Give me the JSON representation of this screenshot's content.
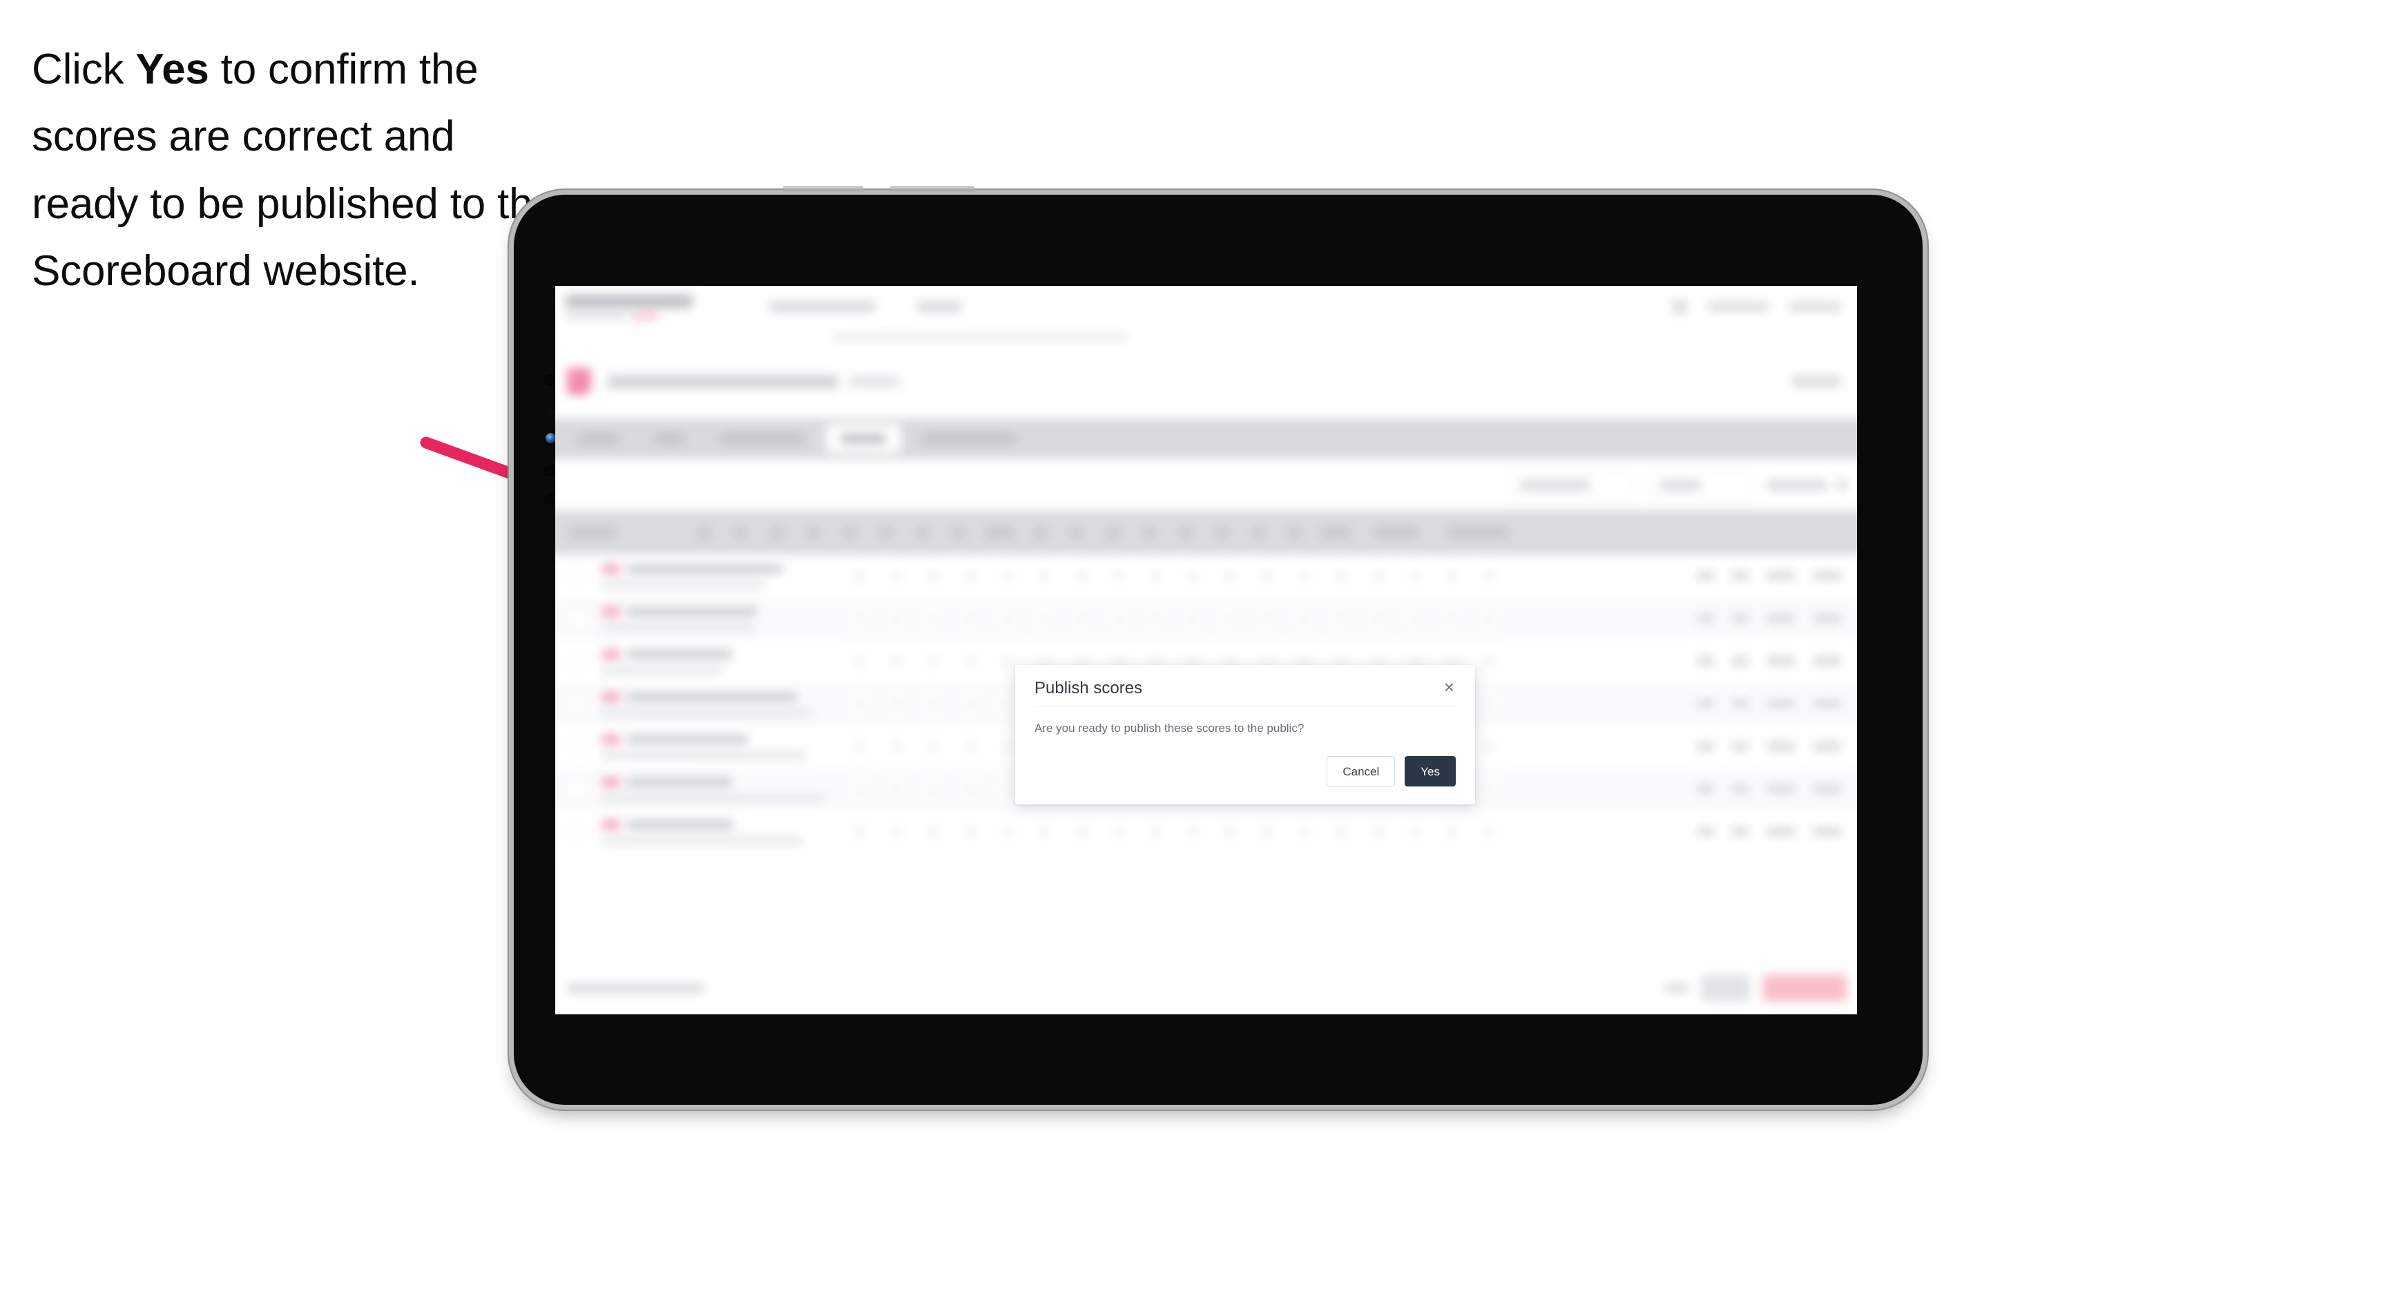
{
  "caption": {
    "part1": "Click ",
    "emphasis": "Yes",
    "part2": " to confirm the scores are correct and ready to be published to the Scoreboard website."
  },
  "annotation": {
    "arrow_color": "#e8265e",
    "arrow_name": "pink-instruction-arrow",
    "points_to": "publish-scores-modal"
  },
  "device": {
    "name": "tablet",
    "orientation": "landscape",
    "frame_color": "#b9b9ba",
    "screen_background": "#0a0a0a"
  },
  "modal": {
    "title": "Publish scores",
    "close_label": "×",
    "body": "Are you ready to publish these scores to the public?",
    "cancel_label": "Cancel",
    "confirm_label": "Yes",
    "confirm_color": "#2b3647",
    "cancel_border_color": "#cfdbe8"
  },
  "app_background": {
    "blurred": true,
    "note": "Scoreboard results table screen behind the dialog (visually blurred)",
    "tabs_count": 5,
    "active_tab_index": 3,
    "table_rows": 7,
    "accent_color": "#f59ab4",
    "publish_button_color": "#f7b9c4"
  }
}
